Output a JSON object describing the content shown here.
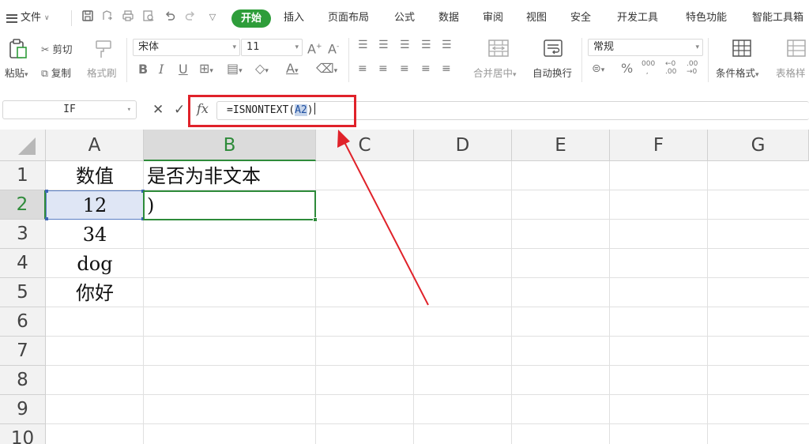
{
  "menubar": {
    "file_label": "文件",
    "tabs": [
      "开始",
      "插入",
      "页面布局",
      "公式",
      "数据",
      "审阅",
      "视图",
      "安全",
      "开发工具",
      "特色功能",
      "智能工具箱"
    ]
  },
  "ribbon": {
    "paste_label": "粘贴",
    "cut_label": "剪切",
    "copy_label": "复制",
    "format_painter_label": "格式刷",
    "font_name": "宋体",
    "font_size": "11",
    "merge_label": "合并居中",
    "wrap_label": "自动换行",
    "number_format": "常规",
    "cond_format_label": "条件格式",
    "table_style_label": "表格样"
  },
  "formula_bar": {
    "name_box": "IF",
    "fx_label": "fx",
    "formula_prefix": "=ISNONTEXT(",
    "formula_ref": "A2",
    "formula_suffix": ")"
  },
  "grid": {
    "columns": [
      "A",
      "B",
      "C",
      "D",
      "E",
      "F",
      "G"
    ],
    "rows": [
      "1",
      "2",
      "3",
      "4",
      "5",
      "6",
      "7",
      "8",
      "9",
      "10"
    ],
    "cells": {
      "A1": "数值",
      "B1": "是否为非文本",
      "A2": "12",
      "B2": ")",
      "A3": "34",
      "A4": "dog",
      "A5": "你好"
    }
  },
  "colors": {
    "accent_green": "#2e9d3a",
    "annotation_red": "#e0222a",
    "selection_blue": "#dfe6f5"
  }
}
